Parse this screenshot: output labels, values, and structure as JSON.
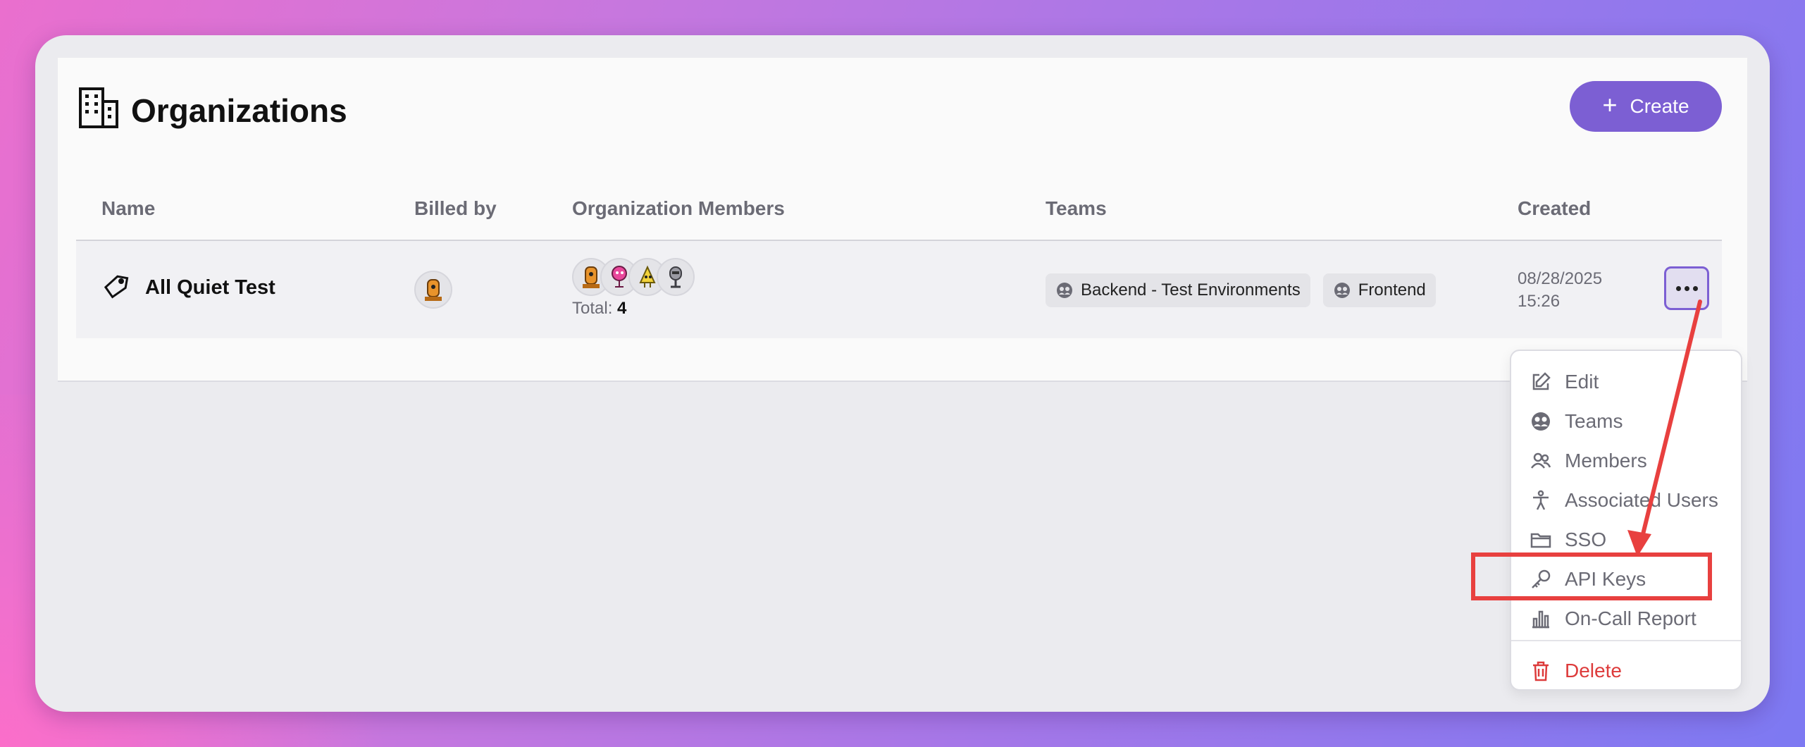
{
  "page": {
    "title": "Organizations",
    "create_label": "Create"
  },
  "table": {
    "headers": {
      "name": "Name",
      "billed_by": "Billed by",
      "members": "Organization Members",
      "teams": "Teams",
      "created": "Created"
    },
    "rows": [
      {
        "name": "All Quiet Test",
        "members_total_label": "Total:",
        "members_total": "4",
        "teams": [
          "Backend - Test Environments",
          "Frontend"
        ],
        "created_date": "08/28/2025",
        "created_time": "15:26"
      }
    ]
  },
  "menu": {
    "items": [
      "Edit",
      "Teams",
      "Members",
      "Associated Users",
      "SSO",
      "API Keys",
      "On-Call Report"
    ],
    "delete": "Delete"
  },
  "colors": {
    "accent": "#7c5fd3",
    "danger": "#dd3b3b",
    "annotation": "#e8403f"
  }
}
